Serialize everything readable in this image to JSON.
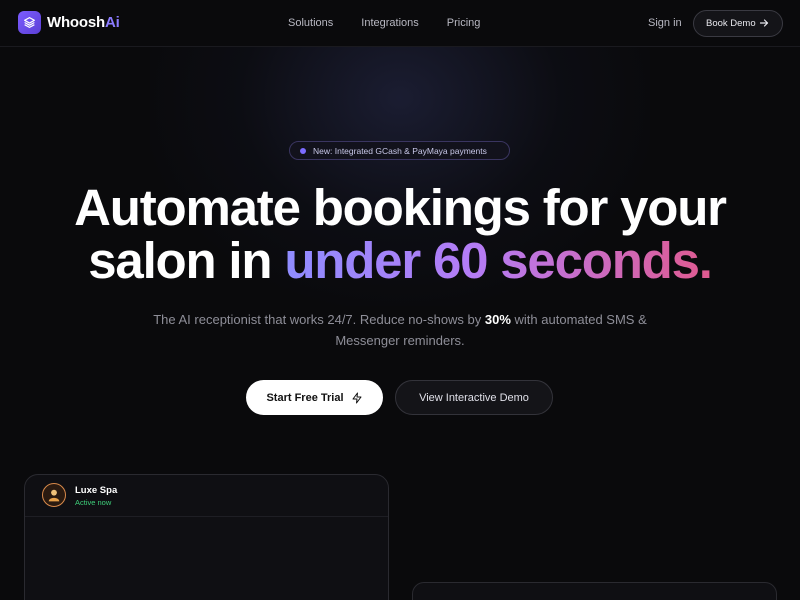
{
  "brand": {
    "name_main": "Whoosh",
    "name_accent": "Ai"
  },
  "nav": {
    "links": [
      "Solutions",
      "Integrations",
      "Pricing"
    ],
    "signin": "Sign in",
    "book_demo": "Book Demo"
  },
  "badge": {
    "text": "New: Integrated GCash & PayMaya payments"
  },
  "hero": {
    "line1": "Automate bookings for your",
    "line2_plain": "salon in ",
    "line2_gradient": "under 60 seconds.",
    "subtitle_pre": "The AI receptionist that works 24/7. Reduce no-shows by ",
    "subtitle_bold": "30%",
    "subtitle_post": " with automated SMS & Messenger reminders.",
    "cta_primary": "Start Free Trial",
    "cta_secondary": "View Interactive Demo"
  },
  "chat_card": {
    "name": "Luxe Spa",
    "status": "Active now"
  },
  "colors": {
    "accent": "#7c5cff",
    "status_green": "#3ecf7a",
    "gradient_end": "#e05a8f"
  },
  "icons": {
    "logo": "layers-icon",
    "arrow": "arrow-right-icon",
    "bolt": "lightning-icon"
  }
}
